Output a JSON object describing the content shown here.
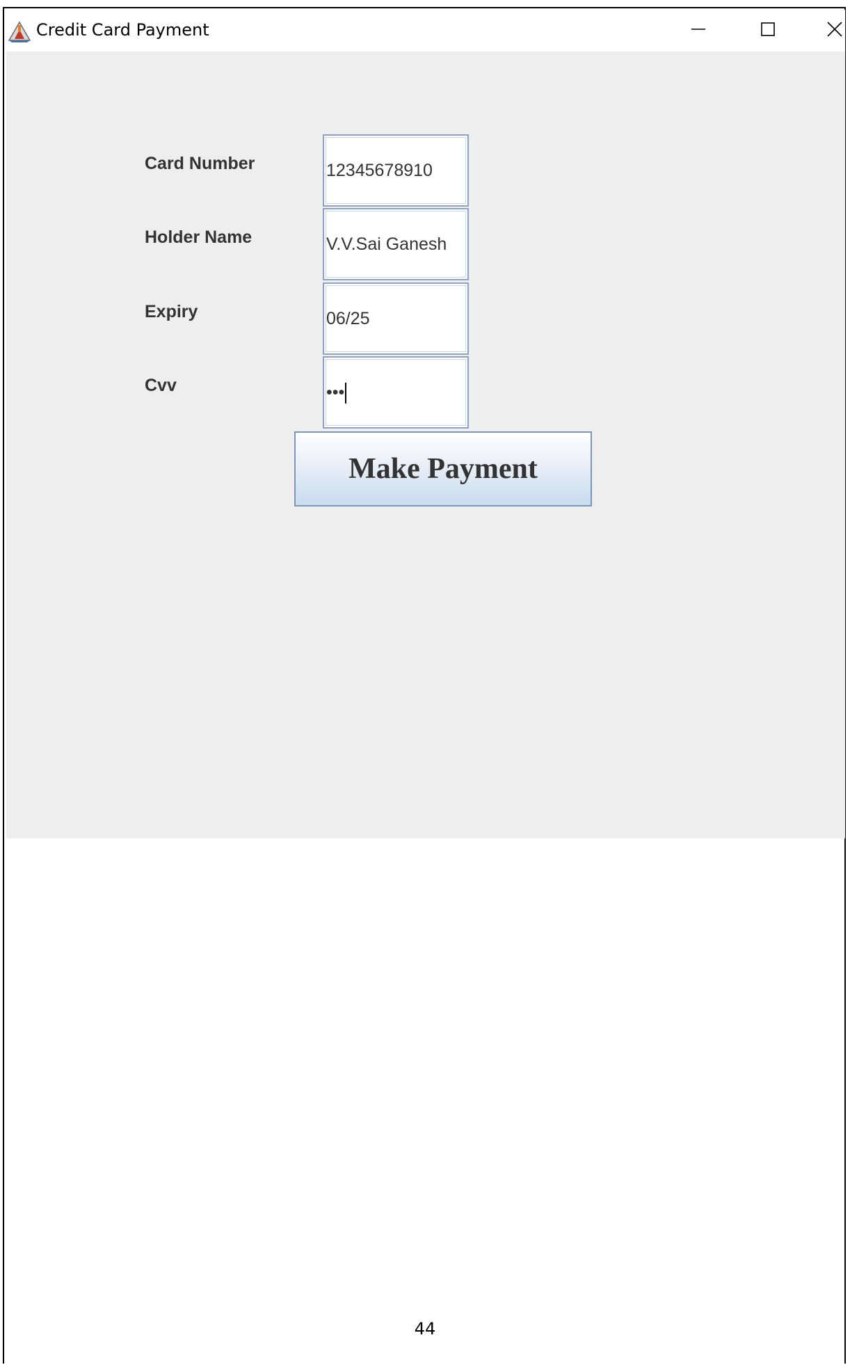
{
  "window": {
    "title": "Credit Card Payment"
  },
  "form": {
    "fields": [
      {
        "label": "Card Number",
        "value": "12345678910"
      },
      {
        "label": "Holder Name",
        "value": "V.V.Sai Ganesh"
      },
      {
        "label": "Expiry",
        "value": "06/25"
      },
      {
        "label": "Cvv",
        "value": "•••"
      }
    ],
    "submit_label": "Make Payment"
  },
  "document": {
    "page_number": "44"
  },
  "icons": {
    "app": "java-app-icon",
    "minimize": "minimize-icon",
    "maximize": "maximize-icon",
    "close": "close-icon"
  }
}
